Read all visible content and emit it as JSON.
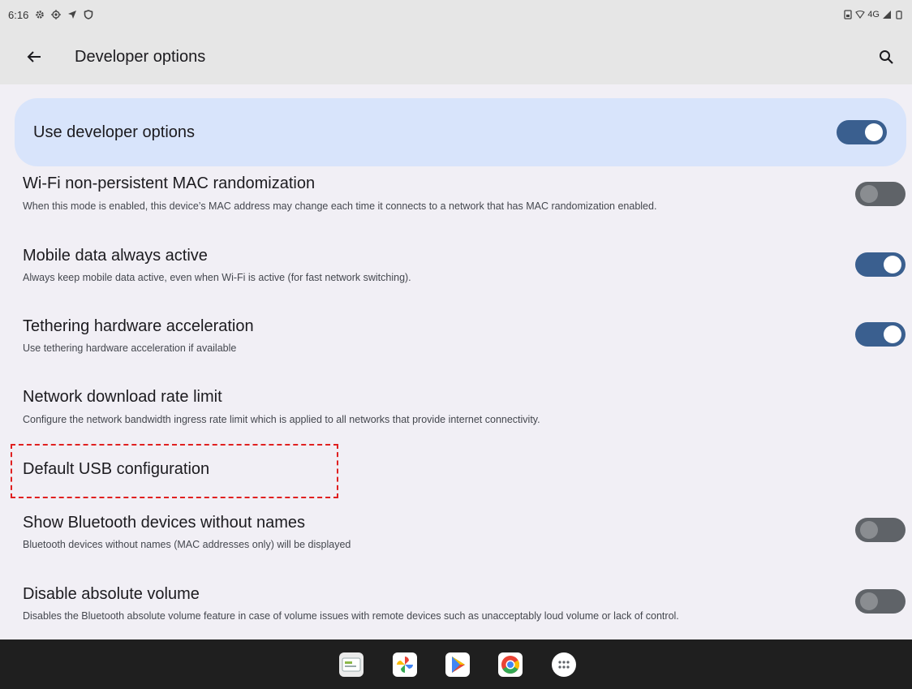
{
  "status_bar": {
    "time": "6:16",
    "network": "4G",
    "icons": [
      "settings-icon",
      "gps-icon",
      "location-arrow-icon",
      "shield-icon",
      "sim-icon",
      "wifi-icon",
      "signal-icon",
      "battery-icon"
    ]
  },
  "app_bar": {
    "title": "Developer options",
    "back_icon": "back-arrow-icon",
    "search_icon": "search-icon"
  },
  "master_switch": {
    "label": "Use developer options",
    "enabled": true
  },
  "settings": [
    {
      "title": "Wi-Fi non-persistent MAC randomization",
      "subtitle": "When this mode is enabled, this device’s MAC address may change each time it connects to a network that has MAC randomization enabled.",
      "toggle": false
    },
    {
      "title": "Mobile data always active",
      "subtitle": "Always keep mobile data active, even when Wi-Fi is active (for fast network switching).",
      "toggle": true
    },
    {
      "title": "Tethering hardware acceleration",
      "subtitle": "Use tethering hardware acceleration if available",
      "toggle": true
    },
    {
      "title": "Network download rate limit",
      "subtitle": "Configure the network bandwidth ingress rate limit which is applied to all networks that provide internet connectivity."
    },
    {
      "title": "Default USB configuration"
    },
    {
      "title": "Show Bluetooth devices without names",
      "subtitle": "Bluetooth devices without names (MAC addresses only) will be displayed",
      "toggle": false
    },
    {
      "title": "Disable absolute volume",
      "subtitle": "Disables the Bluetooth absolute volume feature in case of volume issues with remote devices such as unacceptably loud volume or lack of control.",
      "toggle": false
    }
  ],
  "dock": {
    "apps": [
      "files-app-icon",
      "photos-app-icon",
      "play-store-app-icon",
      "chrome-app-icon",
      "app-drawer-icon"
    ]
  },
  "colors": {
    "toggle_on": "#3a5f8f",
    "toggle_off": "#5f6368",
    "master_card": "#d8e4fb",
    "highlight": "#e02020"
  }
}
